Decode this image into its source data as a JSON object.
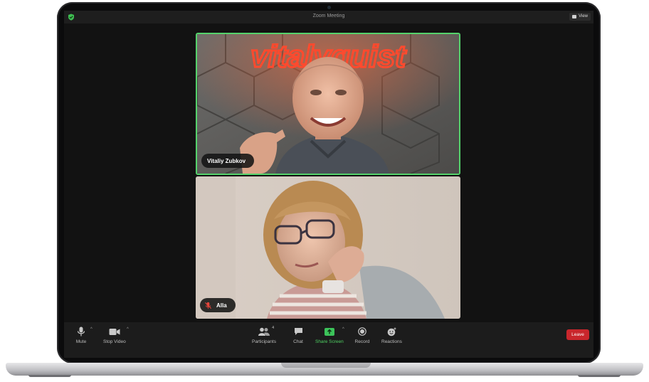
{
  "window": {
    "title": "Zoom Meeting",
    "view_label": "View"
  },
  "participants_video": [
    {
      "name": "Vitaliy Zubkov",
      "active_speaker": true,
      "background_sign": "vitalyquist"
    },
    {
      "name": "Alla",
      "muted": true
    }
  ],
  "toolbar": {
    "mute_label": "Mute",
    "stop_video_label": "Stop Video",
    "participants_label": "Participants",
    "participants_count": "4",
    "chat_label": "Chat",
    "share_screen_label": "Share Screen",
    "record_label": "Record",
    "reactions_label": "Reactions",
    "leave_label": "Leave"
  },
  "colors": {
    "active_speaker_border": "#54d26b",
    "share_green": "#4fd163",
    "leave_red": "#c9262c",
    "neon_sign": "#ff4a2e"
  },
  "icons": [
    "shield-icon",
    "view-grid-icon",
    "mic-icon",
    "video-camera-icon",
    "participants-icon",
    "chat-icon",
    "share-screen-icon",
    "record-icon",
    "reactions-icon",
    "muted-mic-icon",
    "caret-up-icon"
  ]
}
